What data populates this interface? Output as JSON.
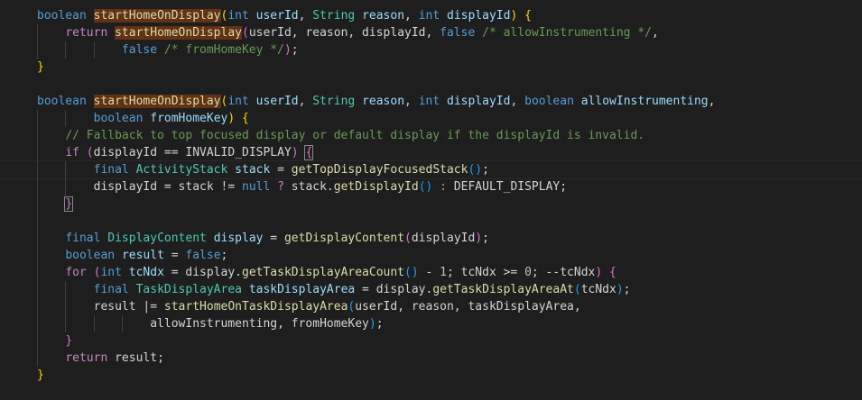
{
  "window": {
    "background": "#1e1e1e"
  },
  "theme": {
    "keyword": "#569cd6",
    "control": "#c586c0",
    "type": "#4ec9b0",
    "function": "#dcdcaa",
    "variable": "#9cdcfe",
    "number": "#b5cea8",
    "comment": "#6a9955",
    "text": "#d4d4d4",
    "bracket_1": "#ffd700",
    "bracket_2": "#da70d6",
    "bracket_3": "#179fff",
    "selection_highlight": "#613214"
  },
  "editor": {
    "language": "Java",
    "lines": [
      {
        "indent": 0,
        "tokens": [
          {
            "t": "boolean",
            "c": "kw"
          },
          {
            "t": " "
          },
          {
            "t": "startHomeOnDisplay",
            "c": "fn",
            "hl": true
          },
          {
            "t": "(",
            "c": "b1"
          },
          {
            "t": "int",
            "c": "kw"
          },
          {
            "t": " "
          },
          {
            "t": "userId",
            "c": "var"
          },
          {
            "t": ", "
          },
          {
            "t": "String",
            "c": "ty"
          },
          {
            "t": " "
          },
          {
            "t": "reason",
            "c": "var"
          },
          {
            "t": ", "
          },
          {
            "t": "int",
            "c": "kw"
          },
          {
            "t": " "
          },
          {
            "t": "displayId",
            "c": "var"
          },
          {
            "t": ")",
            "c": "b1"
          },
          {
            "t": " "
          },
          {
            "t": "{",
            "c": "b1"
          }
        ]
      },
      {
        "indent": 1,
        "tokens": [
          {
            "t": "    "
          },
          {
            "t": "return",
            "c": "ctl"
          },
          {
            "t": " "
          },
          {
            "t": "startHomeOnDisplay",
            "c": "fn",
            "hl": true
          },
          {
            "t": "(",
            "c": "b2"
          },
          {
            "t": "userId, reason, displayId, "
          },
          {
            "t": "false",
            "c": "kw"
          },
          {
            "t": " "
          },
          {
            "t": "/* allowInstrumenting */",
            "c": "cm"
          },
          {
            "t": ","
          }
        ]
      },
      {
        "indent": 3,
        "tokens": [
          {
            "t": "            "
          },
          {
            "t": "false",
            "c": "kw"
          },
          {
            "t": " "
          },
          {
            "t": "/* fromHomeKey */",
            "c": "cm"
          },
          {
            "t": ")",
            "c": "b2"
          },
          {
            "t": ";"
          }
        ]
      },
      {
        "indent": 0,
        "tokens": [
          {
            "t": "}",
            "c": "b1"
          }
        ]
      },
      {
        "indent": 0,
        "tokens": []
      },
      {
        "indent": 0,
        "tokens": [
          {
            "t": "boolean",
            "c": "kw"
          },
          {
            "t": " "
          },
          {
            "t": "startHomeOnDisplay",
            "c": "fn",
            "hl": true
          },
          {
            "t": "(",
            "c": "b1"
          },
          {
            "t": "int",
            "c": "kw"
          },
          {
            "t": " "
          },
          {
            "t": "userId",
            "c": "var"
          },
          {
            "t": ", "
          },
          {
            "t": "String",
            "c": "ty"
          },
          {
            "t": " "
          },
          {
            "t": "reason",
            "c": "var"
          },
          {
            "t": ", "
          },
          {
            "t": "int",
            "c": "kw"
          },
          {
            "t": " "
          },
          {
            "t": "displayId",
            "c": "var"
          },
          {
            "t": ", "
          },
          {
            "t": "boolean",
            "c": "kw"
          },
          {
            "t": " "
          },
          {
            "t": "allowInstrumenting",
            "c": "var"
          },
          {
            "t": ","
          }
        ]
      },
      {
        "indent": 2,
        "tokens": [
          {
            "t": "        "
          },
          {
            "t": "boolean",
            "c": "kw"
          },
          {
            "t": " "
          },
          {
            "t": "fromHomeKey",
            "c": "var"
          },
          {
            "t": ")",
            "c": "b1"
          },
          {
            "t": " "
          },
          {
            "t": "{",
            "c": "b1"
          }
        ]
      },
      {
        "indent": 1,
        "tokens": [
          {
            "t": "    "
          },
          {
            "t": "// Fallback to top focused display or default display if the displayId is invalid.",
            "c": "cm"
          }
        ]
      },
      {
        "indent": 1,
        "tokens": [
          {
            "t": "    "
          },
          {
            "t": "if",
            "c": "ctl"
          },
          {
            "t": " "
          },
          {
            "t": "(",
            "c": "b2"
          },
          {
            "t": "displayId == "
          },
          {
            "t": "INVALID_DISPLAY",
            "c": "cn"
          },
          {
            "t": ")",
            "c": "b2"
          },
          {
            "t": " "
          },
          {
            "t": "{",
            "c": "b2",
            "bm": true
          }
        ]
      },
      {
        "indent": 2,
        "current": true,
        "tokens": [
          {
            "t": "        "
          },
          {
            "t": "final",
            "c": "kw"
          },
          {
            "t": " "
          },
          {
            "t": "ActivityStack",
            "c": "ty"
          },
          {
            "t": " "
          },
          {
            "t": "stack",
            "c": "var"
          },
          {
            "t": " = "
          },
          {
            "t": "getTopDisplayFocusedStack",
            "c": "fn"
          },
          {
            "t": "()",
            "c": "b3"
          },
          {
            "t": ";"
          }
        ]
      },
      {
        "indent": 2,
        "tokens": [
          {
            "t": "        "
          },
          {
            "t": "displayId = stack != "
          },
          {
            "t": "null",
            "c": "kw"
          },
          {
            "t": " "
          },
          {
            "t": "?",
            "c": "ctl"
          },
          {
            "t": " stack."
          },
          {
            "t": "getDisplayId",
            "c": "fn"
          },
          {
            "t": "()",
            "c": "b3"
          },
          {
            "t": " "
          },
          {
            "t": ":",
            "c": "ctl"
          },
          {
            "t": " DEFAULT_DISPLAY;"
          }
        ]
      },
      {
        "indent": 1,
        "tokens": [
          {
            "t": "    "
          },
          {
            "t": "}",
            "c": "b2",
            "bm": true
          }
        ]
      },
      {
        "indent": 1,
        "tokens": []
      },
      {
        "indent": 1,
        "tokens": [
          {
            "t": "    "
          },
          {
            "t": "final",
            "c": "kw"
          },
          {
            "t": " "
          },
          {
            "t": "DisplayContent",
            "c": "ty"
          },
          {
            "t": " "
          },
          {
            "t": "display",
            "c": "var"
          },
          {
            "t": " = "
          },
          {
            "t": "getDisplayContent",
            "c": "fn"
          },
          {
            "t": "(",
            "c": "b2"
          },
          {
            "t": "displayId"
          },
          {
            "t": ")",
            "c": "b2"
          },
          {
            "t": ";"
          }
        ]
      },
      {
        "indent": 1,
        "tokens": [
          {
            "t": "    "
          },
          {
            "t": "boolean",
            "c": "kw"
          },
          {
            "t": " "
          },
          {
            "t": "result",
            "c": "var"
          },
          {
            "t": " = "
          },
          {
            "t": "false",
            "c": "kw"
          },
          {
            "t": ";"
          }
        ]
      },
      {
        "indent": 1,
        "tokens": [
          {
            "t": "    "
          },
          {
            "t": "for",
            "c": "ctl"
          },
          {
            "t": " "
          },
          {
            "t": "(",
            "c": "b2"
          },
          {
            "t": "int",
            "c": "kw"
          },
          {
            "t": " "
          },
          {
            "t": "tcNdx",
            "c": "var"
          },
          {
            "t": " = display."
          },
          {
            "t": "getTaskDisplayAreaCount",
            "c": "fn"
          },
          {
            "t": "()",
            "c": "b3"
          },
          {
            "t": " - "
          },
          {
            "t": "1",
            "c": "num"
          },
          {
            "t": "; tcNdx >= "
          },
          {
            "t": "0",
            "c": "num"
          },
          {
            "t": "; --tcNdx"
          },
          {
            "t": ")",
            "c": "b2"
          },
          {
            "t": " "
          },
          {
            "t": "{",
            "c": "b2"
          }
        ]
      },
      {
        "indent": 2,
        "tokens": [
          {
            "t": "        "
          },
          {
            "t": "final",
            "c": "kw"
          },
          {
            "t": " "
          },
          {
            "t": "TaskDisplayArea",
            "c": "ty"
          },
          {
            "t": " "
          },
          {
            "t": "taskDisplayArea",
            "c": "var"
          },
          {
            "t": " = display."
          },
          {
            "t": "getTaskDisplayAreaAt",
            "c": "fn"
          },
          {
            "t": "(",
            "c": "b3"
          },
          {
            "t": "tcNdx"
          },
          {
            "t": ")",
            "c": "b3"
          },
          {
            "t": ";"
          }
        ]
      },
      {
        "indent": 2,
        "tokens": [
          {
            "t": "        "
          },
          {
            "t": "result |= "
          },
          {
            "t": "startHomeOnTaskDisplayArea",
            "c": "fn"
          },
          {
            "t": "(",
            "c": "b3"
          },
          {
            "t": "userId, reason, taskDisplayArea,"
          }
        ]
      },
      {
        "indent": 4,
        "tokens": [
          {
            "t": "                "
          },
          {
            "t": "allowInstrumenting, fromHomeKey"
          },
          {
            "t": ")",
            "c": "b3"
          },
          {
            "t": ";"
          }
        ]
      },
      {
        "indent": 1,
        "tokens": [
          {
            "t": "    "
          },
          {
            "t": "}",
            "c": "b2"
          }
        ]
      },
      {
        "indent": 1,
        "tokens": [
          {
            "t": "    "
          },
          {
            "t": "return",
            "c": "ctl"
          },
          {
            "t": " result;"
          }
        ]
      },
      {
        "indent": 0,
        "tokens": [
          {
            "t": "}",
            "c": "b1"
          }
        ]
      }
    ]
  }
}
